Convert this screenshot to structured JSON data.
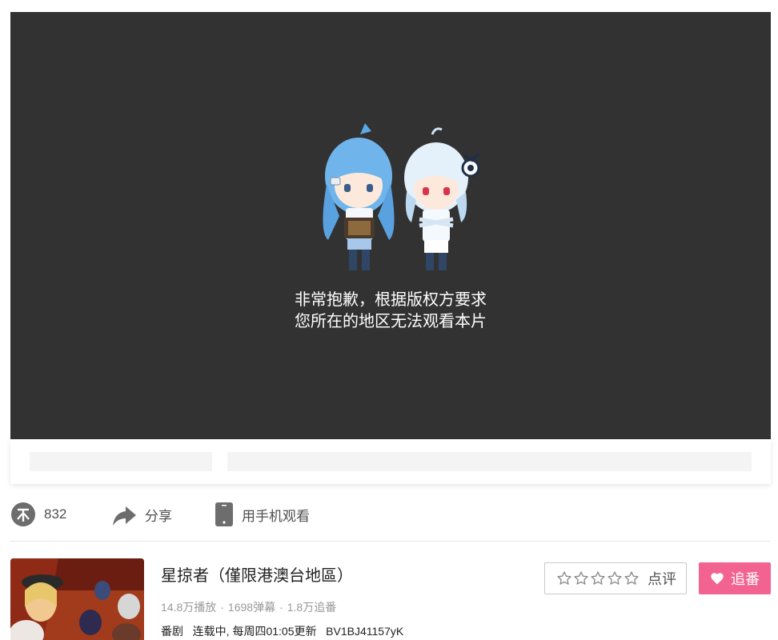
{
  "player": {
    "message_line1": "非常抱歉，根据版权方要求",
    "message_line2": "您所在的地区无法观看本片"
  },
  "actions": {
    "coin_count": "832",
    "share_label": "分享",
    "mobile_label": "用手机观看"
  },
  "media": {
    "title": "星掠者（僅限港澳台地區）",
    "play_count": "14.8万播放",
    "danmaku_count": "1698弹幕",
    "follow_count": "1.8万追番",
    "stats_separator": "·",
    "type": "番剧",
    "status": "连载中, 每周四01:05更新",
    "bvid": "BV1BJ41157yK"
  },
  "buttons": {
    "rate_label": "点评",
    "follow_label": "追番"
  },
  "colors": {
    "player_bg": "#323232",
    "accent_pink": "#f36392",
    "muted_text": "#999999"
  },
  "icons": {
    "coin": "coin-icon",
    "share": "share-arrow-icon",
    "mobile": "phone-icon",
    "star": "star-outline-icon",
    "heart": "heart-icon"
  }
}
